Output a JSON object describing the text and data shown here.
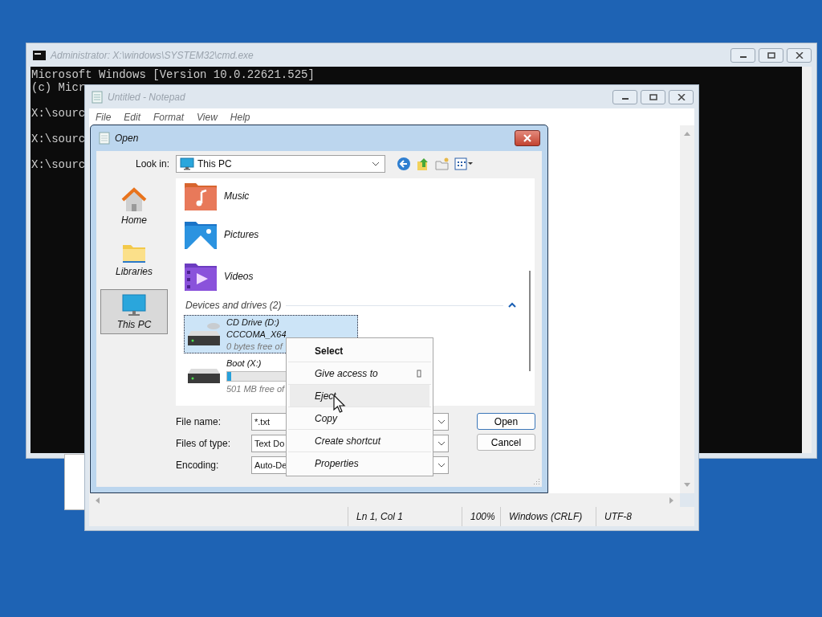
{
  "console_window": {
    "title": "Administrator: X:\\windows\\SYSTEM32\\cmd.exe",
    "lines": [
      "Microsoft Windows [Version 10.0.22621.525]",
      "(c) Micr",
      "X:\\sourc",
      "X:\\sourc",
      "X:\\sourc"
    ]
  },
  "notepad": {
    "title": "Untitled - Notepad",
    "menu": [
      "File",
      "Edit",
      "Format",
      "View",
      "Help"
    ],
    "status_bar": [
      "Ln 1, Col 1",
      "100%",
      "Windows (CRLF)",
      "UTF-8"
    ]
  },
  "open_dialog": {
    "title": "Open",
    "look_in": {
      "label": "Look in:",
      "value": "This PC"
    },
    "places": [
      {
        "label": "Home",
        "selected": false
      },
      {
        "label": "Libraries",
        "selected": false
      },
      {
        "label": "This PC",
        "selected": true
      }
    ],
    "folders": [
      {
        "label": "Music"
      },
      {
        "label": "Pictures"
      },
      {
        "label": "Videos"
      }
    ],
    "group": {
      "label": "Devices and drives (2)",
      "expanded": true
    },
    "drives": [
      {
        "name": "CD Drive (D:)",
        "volume": "CCCOMA_X64",
        "free": "0 bytes free of",
        "selected": true
      },
      {
        "name": "Boot (X:)",
        "level": 0.03,
        "free": "501 MB free of",
        "selected": false
      }
    ],
    "fields": [
      {
        "label": "File name:",
        "value": "*.txt"
      },
      {
        "label": "Files of type:",
        "value": "Text Do"
      },
      {
        "label": "Encoding:",
        "value": "Auto-De"
      }
    ],
    "buttons": [
      "Open",
      "Cancel"
    ]
  },
  "context_menu": {
    "items": [
      {
        "label": "Select",
        "default": true,
        "submenu": false,
        "highlighted": false
      },
      {
        "label": "Give access to",
        "default": false,
        "submenu": true,
        "highlighted": false
      },
      {
        "label": "Eject",
        "default": false,
        "submenu": false,
        "highlighted": true
      },
      {
        "label": "Copy",
        "default": false,
        "submenu": false,
        "highlighted": false
      },
      {
        "label": "Create shortcut",
        "default": false,
        "submenu": false,
        "highlighted": false
      },
      {
        "label": "Properties",
        "default": false,
        "submenu": false,
        "highlighted": false
      }
    ]
  }
}
